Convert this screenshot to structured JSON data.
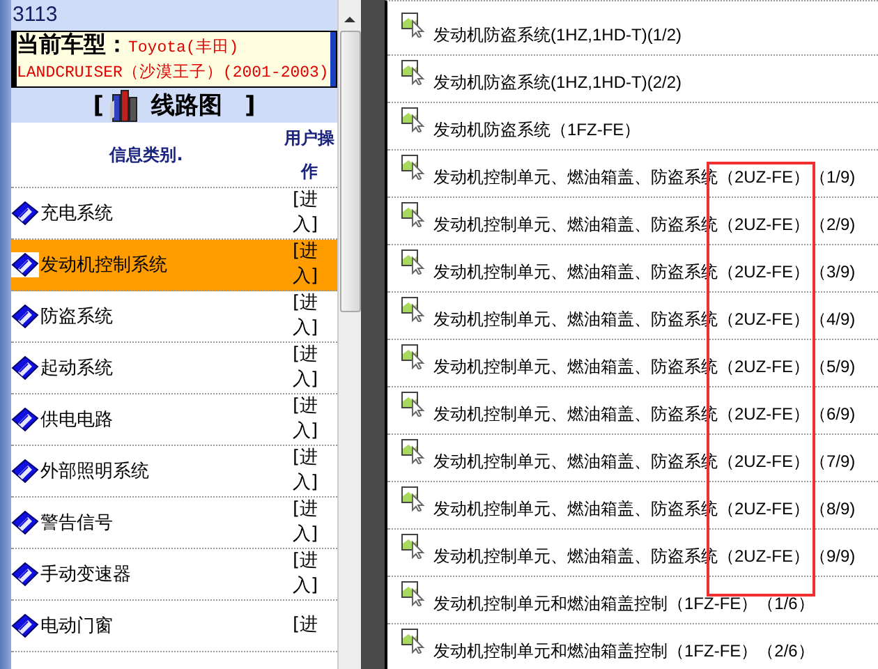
{
  "panel_number": "3113",
  "vehicle": {
    "label": "当前车型：",
    "model": "Toyota(丰田) LANDCRUISER（沙漠王子）(2001-2003)"
  },
  "section": {
    "open": "[",
    "title": "线路图",
    "close": "]"
  },
  "columns": [
    "信息类别.",
    "用户操作"
  ],
  "categories": [
    {
      "name": "充电系统",
      "action": "[进入]",
      "selected": false
    },
    {
      "name": "发动机控制系统",
      "action": "[进入]",
      "selected": true
    },
    {
      "name": "防盗系统",
      "action": "[进入]",
      "selected": false
    },
    {
      "name": "起动系统",
      "action": "[进入]",
      "selected": false
    },
    {
      "name": "供电电路",
      "action": "[进入]",
      "selected": false
    },
    {
      "name": "外部照明系统",
      "action": "[进入]",
      "selected": false
    },
    {
      "name": "警告信号",
      "action": "[进入]",
      "selected": false
    },
    {
      "name": "手动变速器",
      "action": "[进入]",
      "selected": false
    },
    {
      "name": "电动门窗",
      "action": "[进",
      "selected": false
    }
  ],
  "documents": [
    {
      "title": "发动机防盗系统(1HZ,1HD-T)(1/2)"
    },
    {
      "title": "发动机防盗系统(1HZ,1HD-T)(2/2)"
    },
    {
      "title": "发动机防盗系统（1FZ-FE）"
    },
    {
      "title": "发动机控制单元、燃油箱盖、防盗系统（2UZ-FE）（1/9)"
    },
    {
      "title": "发动机控制单元、燃油箱盖、防盗系统（2UZ-FE）（2/9)"
    },
    {
      "title": "发动机控制单元、燃油箱盖、防盗系统（2UZ-FE）（3/9)"
    },
    {
      "title": "发动机控制单元、燃油箱盖、防盗系统（2UZ-FE）（4/9)"
    },
    {
      "title": "发动机控制单元、燃油箱盖、防盗系统（2UZ-FE）（5/9)"
    },
    {
      "title": "发动机控制单元、燃油箱盖、防盗系统（2UZ-FE）（6/9)"
    },
    {
      "title": "发动机控制单元、燃油箱盖、防盗系统（2UZ-FE）（7/9)"
    },
    {
      "title": "发动机控制单元、燃油箱盖、防盗系统（2UZ-FE）（8/9)"
    },
    {
      "title": "发动机控制单元、燃油箱盖、防盗系统（2UZ-FE）（9/9)"
    },
    {
      "title": "发动机控制单元和燃油箱盖控制（1FZ-FE）（1/6）"
    },
    {
      "title": "发动机控制单元和燃油箱盖控制（1FZ-FE）（2/6）"
    }
  ]
}
